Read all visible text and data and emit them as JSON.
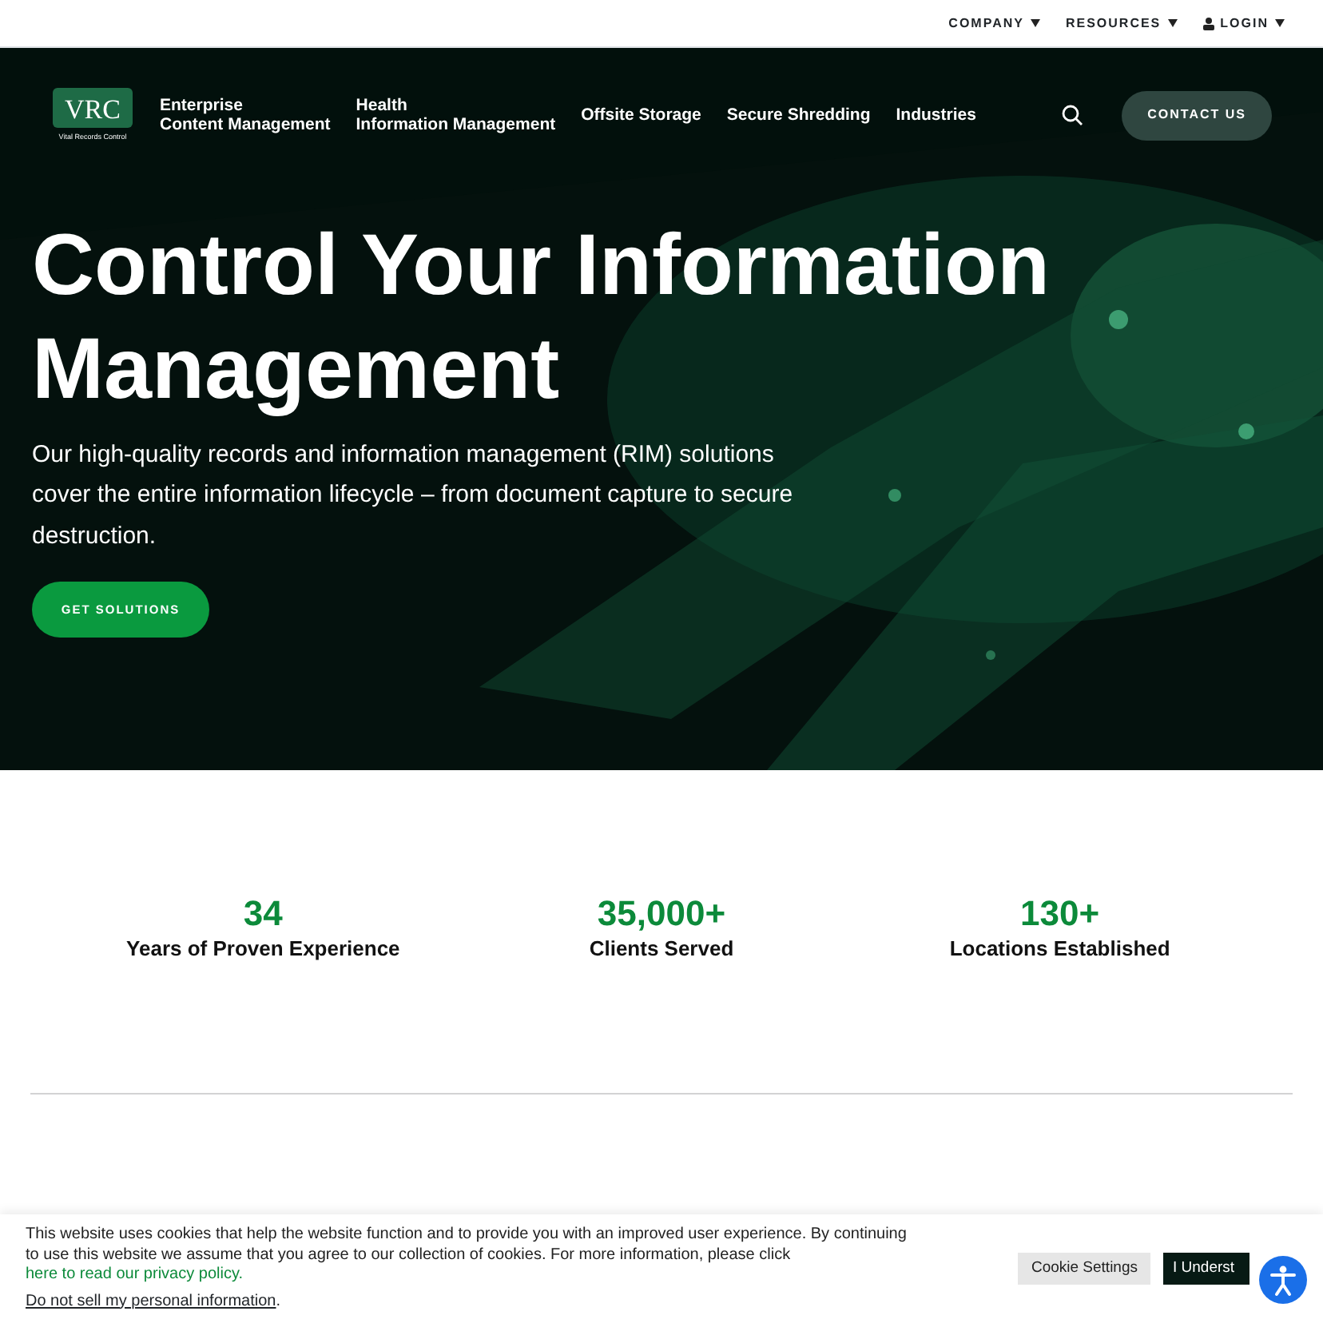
{
  "top_menu": [
    {
      "label": "COMPANY",
      "icon": false
    },
    {
      "label": "RESOURCES",
      "icon": false
    },
    {
      "label": "LOGIN",
      "icon": true
    }
  ],
  "logo": {
    "text": "VRC",
    "subtitle": "Vital Records Control"
  },
  "nav": [
    {
      "lines": [
        "Enterprise",
        "Content Management"
      ]
    },
    {
      "lines": [
        "Health",
        "Information Management"
      ]
    },
    {
      "lines": [
        "Offsite Storage"
      ]
    },
    {
      "lines": [
        "Secure Shredding"
      ]
    },
    {
      "lines": [
        "Industries"
      ]
    }
  ],
  "contact_button": "CONTACT US",
  "hero": {
    "kind": "picture",
    "title": "Control Your Information Management",
    "text": "Our high-quality records and information management (RIM) solutions cover the entire information lifecycle – from document capture to secure destruction.",
    "button": "GET SOLUTIONS"
  },
  "stats": [
    {
      "value": "34",
      "label": "Years of Proven Experience"
    },
    {
      "value": "35,000+",
      "label": "Clients Served"
    },
    {
      "value": "130+",
      "label": "Locations Established"
    }
  ],
  "cookie": {
    "text": "This website uses cookies that help the website function and to provide you with an improved user experience. By continuing to use this website we assume that you agree to our collection of cookies. For more information, please click",
    "link": "here to read our privacy policy.",
    "dnsell": "Do not sell my personal information",
    "dnsell_end": ".",
    "settings_button": "Cookie Settings",
    "accept_button": "I Underst"
  }
}
